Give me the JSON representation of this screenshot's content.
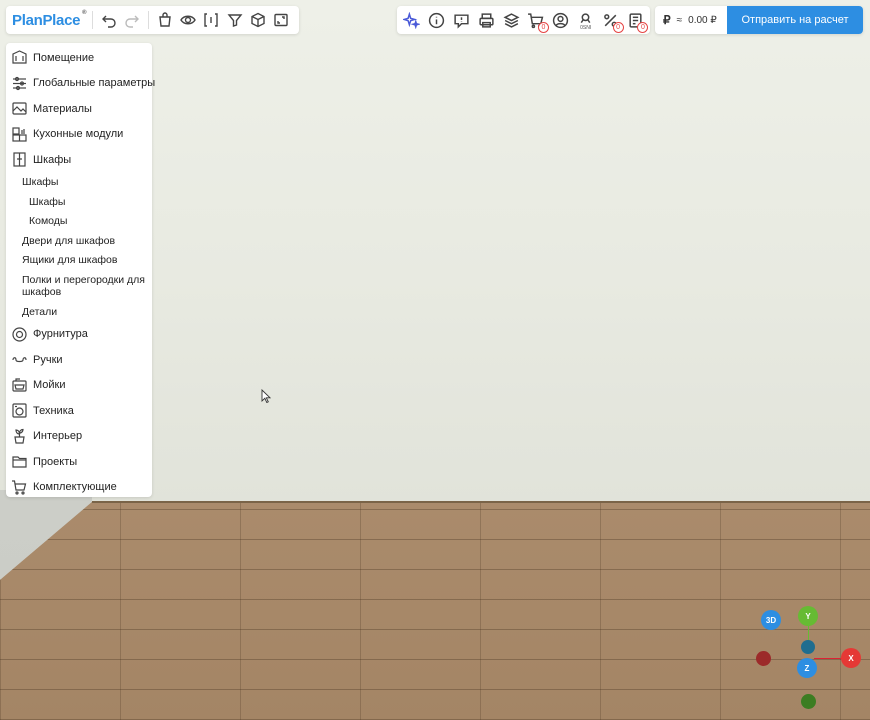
{
  "app": {
    "logo": "PlanPlace",
    "logo_mark": "®"
  },
  "toolbar_left": {
    "buttons": [
      {
        "icon": "undo-icon"
      },
      {
        "icon": "redo-icon"
      },
      {
        "icon": "bag-icon"
      },
      {
        "icon": "eye-icon"
      },
      {
        "icon": "dimensions-icon"
      },
      {
        "icon": "filter-icon"
      },
      {
        "icon": "cube-icon"
      },
      {
        "icon": "fullscreen-icon"
      }
    ]
  },
  "toolbar_right": {
    "buttons": [
      {
        "icon": "ai-sparkle-icon"
      },
      {
        "icon": "info-icon"
      },
      {
        "icon": "chat-icon"
      },
      {
        "icon": "print-icon"
      },
      {
        "icon": "layers-icon"
      },
      {
        "icon": "cart-icon",
        "count": "0"
      },
      {
        "icon": "user-icon"
      },
      {
        "icon": "ruler-icon",
        "label": "0SNI"
      },
      {
        "icon": "percent-icon",
        "count": "0"
      },
      {
        "icon": "spec-list-icon",
        "count": "0"
      }
    ]
  },
  "price": {
    "currency_symbol": "₽",
    "approx": "≈",
    "value": "0.00 ₽",
    "send_label": "Отправить на расчет"
  },
  "sidebar": {
    "items_top": [
      {
        "label": "Помещение",
        "icon": "room-icon"
      },
      {
        "label": "Глобальные параметры",
        "icon": "sliders-icon"
      },
      {
        "label": "Материалы",
        "icon": "materials-icon"
      },
      {
        "label": "Кухонные модули",
        "icon": "kitchen-icon"
      },
      {
        "label": "Шкафы",
        "icon": "wardrobe-icon"
      }
    ],
    "sub_items": [
      {
        "label": "Шкафы",
        "level": 1
      },
      {
        "label": "Шкафы",
        "level": 2
      },
      {
        "label": "Комоды",
        "level": 2
      },
      {
        "label": "Двери для шкафов",
        "level": 1
      },
      {
        "label": "Ящики для шкафов",
        "level": 1
      },
      {
        "label": "Полки и перегородки для шкафов",
        "level": 1
      },
      {
        "label": "Детали",
        "level": 1
      }
    ],
    "items_bottom": [
      {
        "label": "Фурнитура",
        "icon": "hardware-icon"
      },
      {
        "label": "Ручки",
        "icon": "handle-icon"
      },
      {
        "label": "Мойки",
        "icon": "sink-icon"
      },
      {
        "label": "Техника",
        "icon": "appliance-icon"
      },
      {
        "label": "Интерьер",
        "icon": "plant-icon"
      },
      {
        "label": "Проекты",
        "icon": "folder-icon"
      },
      {
        "label": "Комплектующие",
        "icon": "cart-icon"
      }
    ]
  },
  "gizmo": {
    "view_label": "3D",
    "x_label": "X",
    "y_label": "Y",
    "z_label": "Z",
    "colors": {
      "x": "#e53935",
      "y": "#66bb33",
      "z": "#2d8ee2"
    }
  }
}
